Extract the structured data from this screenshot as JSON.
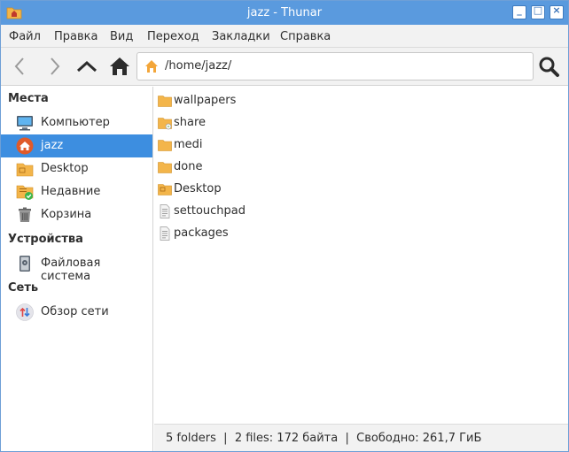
{
  "window": {
    "title": "jazz - Thunar"
  },
  "menu": {
    "items": [
      "Файл",
      "Правка",
      "Вид",
      "Переход",
      "Закладки",
      "Справка"
    ]
  },
  "toolbar": {
    "back_icon": "chevron-left-icon",
    "forward_icon": "chevron-right-icon",
    "up_icon": "chevron-up-icon",
    "home_icon": "home-icon",
    "location": "/home/jazz/",
    "search_icon": "search-icon"
  },
  "sidebar": {
    "places_heading": "Места",
    "places": [
      {
        "label": "Компьютер",
        "icon": "computer-icon"
      },
      {
        "label": "jazz",
        "icon": "home-folder-icon",
        "selected": true
      },
      {
        "label": "Desktop",
        "icon": "desktop-folder-icon"
      },
      {
        "label": "Недавние",
        "icon": "recent-icon"
      },
      {
        "label": "Корзина",
        "icon": "trash-icon"
      }
    ],
    "devices_heading": "Устройства",
    "devices": [
      {
        "label": "Файловая система",
        "icon": "drive-icon"
      }
    ],
    "network_heading": "Сеть",
    "network": [
      {
        "label": "Обзор сети",
        "icon": "network-icon"
      }
    ]
  },
  "files": [
    {
      "name": "wallpapers",
      "type": "folder"
    },
    {
      "name": "share",
      "type": "folder-shared"
    },
    {
      "name": "medi",
      "type": "folder"
    },
    {
      "name": "done",
      "type": "folder"
    },
    {
      "name": "Desktop",
      "type": "folder-desktop"
    },
    {
      "name": "settouchpad",
      "type": "text-file"
    },
    {
      "name": "packages",
      "type": "text-file"
    }
  ],
  "status": "5 folders  |  2 files: 172 байта  |  Свободно: 261,7 ГиБ",
  "colors": {
    "titlebar": "#5a9ade",
    "selection": "#3d8ee0",
    "folder": "#f3b54a"
  }
}
